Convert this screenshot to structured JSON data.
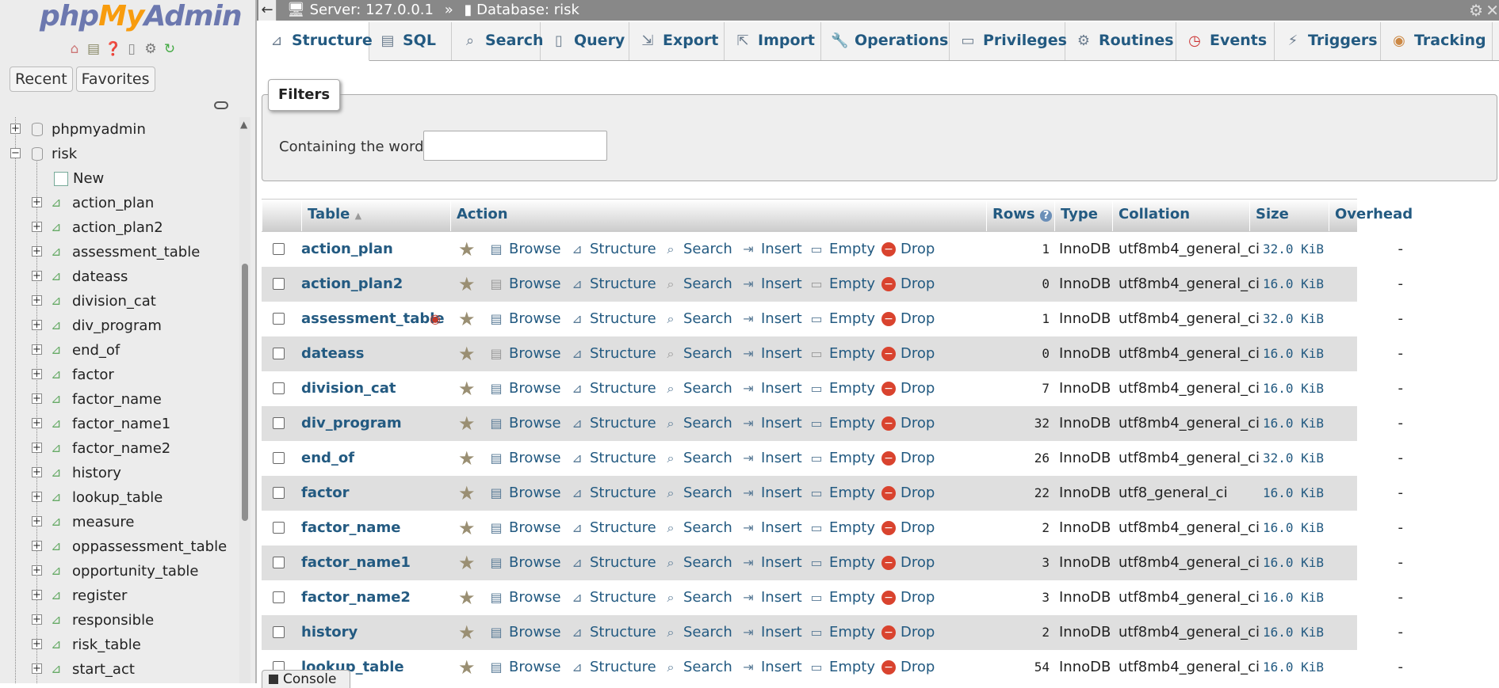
{
  "logo": {
    "part1": "php",
    "part2": "My",
    "part3": "Admin"
  },
  "nav_icons": [
    "home-icon",
    "database-icon",
    "help-icon",
    "docs-icon",
    "settings-icon",
    "reload-icon"
  ],
  "sidebar_tabs": {
    "recent": "Recent",
    "favorites": "Favorites"
  },
  "tree": {
    "db1": "phpmyadmin",
    "db2": "risk",
    "new": "New",
    "tables": [
      "action_plan",
      "action_plan2",
      "assessment_table",
      "dateass",
      "division_cat",
      "div_program",
      "end_of",
      "factor",
      "factor_name",
      "factor_name1",
      "factor_name2",
      "history",
      "lookup_table",
      "measure",
      "oppassessment_table",
      "opportunity_table",
      "register",
      "responsible",
      "risk_table",
      "start_act"
    ]
  },
  "breadcrumb": {
    "server": "Server: 127.0.0.1",
    "sep": "»",
    "database": "Database: risk"
  },
  "tabs": [
    "Structure",
    "SQL",
    "Search",
    "Query",
    "Export",
    "Import",
    "Operations",
    "Privileges",
    "Routines",
    "Events",
    "Triggers",
    "Tracking"
  ],
  "filters": {
    "legend": "Filters",
    "label": "Containing the word:",
    "value": ""
  },
  "headers": {
    "table": "Table",
    "action": "Action",
    "rows": "Rows",
    "type": "Type",
    "collation": "Collation",
    "size": "Size",
    "overhead": "Overhead"
  },
  "actions": {
    "browse": "Browse",
    "structure": "Structure",
    "search": "Search",
    "insert": "Insert",
    "empty": "Empty",
    "drop": "Drop"
  },
  "rows": [
    {
      "name": "action_plan",
      "rows": "1",
      "type": "InnoDB",
      "collation": "utf8mb4_general_ci",
      "size": "32.0 KiB",
      "overhead": "-"
    },
    {
      "name": "action_plan2",
      "rows": "0",
      "type": "InnoDB",
      "collation": "utf8mb4_general_ci",
      "size": "16.0 KiB",
      "overhead": "-"
    },
    {
      "name": "assessment_table",
      "rows": "1",
      "type": "InnoDB",
      "collation": "utf8mb4_general_ci",
      "size": "32.0 KiB",
      "overhead": "-"
    },
    {
      "name": "dateass",
      "rows": "0",
      "type": "InnoDB",
      "collation": "utf8mb4_general_ci",
      "size": "16.0 KiB",
      "overhead": "-"
    },
    {
      "name": "division_cat",
      "rows": "7",
      "type": "InnoDB",
      "collation": "utf8mb4_general_ci",
      "size": "16.0 KiB",
      "overhead": "-"
    },
    {
      "name": "div_program",
      "rows": "32",
      "type": "InnoDB",
      "collation": "utf8mb4_general_ci",
      "size": "16.0 KiB",
      "overhead": "-"
    },
    {
      "name": "end_of",
      "rows": "26",
      "type": "InnoDB",
      "collation": "utf8mb4_general_ci",
      "size": "32.0 KiB",
      "overhead": "-"
    },
    {
      "name": "factor",
      "rows": "22",
      "type": "InnoDB",
      "collation": "utf8_general_ci",
      "size": "16.0 KiB",
      "overhead": "-"
    },
    {
      "name": "factor_name",
      "rows": "2",
      "type": "InnoDB",
      "collation": "utf8mb4_general_ci",
      "size": "16.0 KiB",
      "overhead": "-"
    },
    {
      "name": "factor_name1",
      "rows": "3",
      "type": "InnoDB",
      "collation": "utf8mb4_general_ci",
      "size": "16.0 KiB",
      "overhead": "-"
    },
    {
      "name": "factor_name2",
      "rows": "3",
      "type": "InnoDB",
      "collation": "utf8mb4_general_ci",
      "size": "16.0 KiB",
      "overhead": "-"
    },
    {
      "name": "history",
      "rows": "2",
      "type": "InnoDB",
      "collation": "utf8mb4_general_ci",
      "size": "16.0 KiB",
      "overhead": "-"
    },
    {
      "name": "lookup_table",
      "rows": "54",
      "type": "InnoDB",
      "collation": "utf8mb4_general_ci",
      "size": "16.0 KiB",
      "overhead": "-"
    }
  ],
  "console": "Console"
}
